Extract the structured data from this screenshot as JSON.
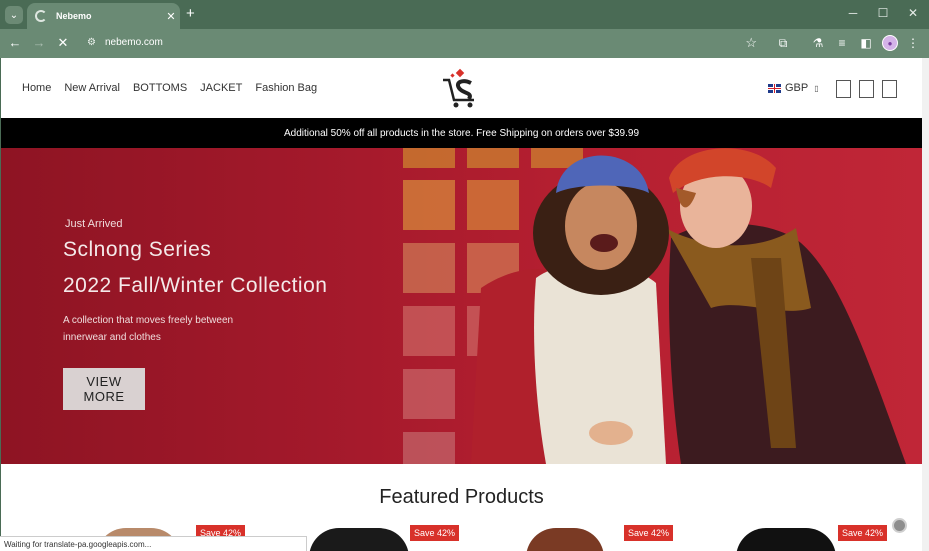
{
  "browser": {
    "tab_title": "Nebemo",
    "tab_close": "✕",
    "new_tab": "+",
    "url": "nebemo.com",
    "window_controls": {
      "minimize": "─",
      "maximize": "☐",
      "close": "✕"
    },
    "status_text": "Waiting for translate-pa.googleapis.com..."
  },
  "header": {
    "menu": [
      "Home",
      "New Arrival",
      "BOTTOMS",
      "JACKET",
      "Fashion Bag"
    ],
    "currency": "GBP",
    "currency_caret": "▯"
  },
  "promo": {
    "text": "Additional 50% off all products in the store. Free Shipping on orders over $39.99"
  },
  "hero": {
    "kicker": "Just Arrived",
    "title": "Sclnong Series",
    "subtitle": "2022 Fall/Winter Collection",
    "description": "A collection that moves freely between innerwear and clothes",
    "button": "VIEW MORE"
  },
  "featured": {
    "heading": "Featured Products",
    "badges": [
      "Save 42%",
      "Save 42%",
      "Save 42%",
      "Save 42%"
    ]
  },
  "colors": {
    "chrome": "#4a6b55",
    "hero_red": "#a3192b",
    "badge_red": "#d8312a",
    "promo_bg": "#000000"
  }
}
